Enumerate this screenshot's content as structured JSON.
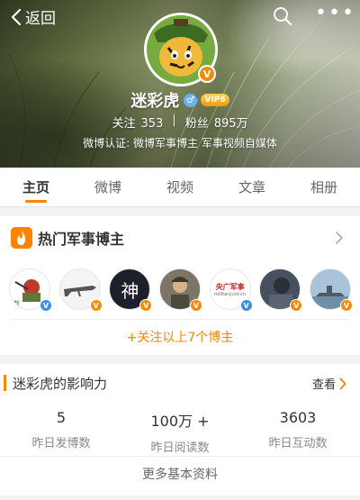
{
  "nav": {
    "back_label": "返回"
  },
  "profile": {
    "name": "迷彩虎",
    "gender_symbol": "♂",
    "vip_label": "VIP6",
    "following_label": "关注",
    "following_count": "353",
    "followers_label": "粉丝",
    "followers_count": "895万",
    "verification": "微博认证: 微博军事博主 军事视频自媒体"
  },
  "tabs": [
    {
      "label": "主页",
      "active": true
    },
    {
      "label": "微博",
      "active": false
    },
    {
      "label": "视频",
      "active": false
    },
    {
      "label": "文章",
      "active": false
    },
    {
      "label": "相册",
      "active": false
    }
  ],
  "hot": {
    "title": "热门军事博主",
    "follow_all_label": "+关注以上7个博主",
    "bloggers": [
      {
        "badge": "blue",
        "pic_text": ""
      },
      {
        "badge": "orange",
        "pic_text": ""
      },
      {
        "badge": "orange",
        "pic_text": "神"
      },
      {
        "badge": "orange",
        "pic_text": ""
      },
      {
        "badge": "blue",
        "pic_text": "央广军事",
        "pic_subtext": "military.cnr.cn"
      },
      {
        "badge": "orange",
        "pic_text": ""
      },
      {
        "badge": "orange",
        "pic_text": ""
      }
    ]
  },
  "influence": {
    "title": "迷彩虎的影响力",
    "more_label": "查看",
    "metrics": [
      {
        "value": "5",
        "label": "昨日发博数"
      },
      {
        "value": "100万 +",
        "label": "昨日阅读数"
      },
      {
        "value": "3603",
        "label": "昨日互动数"
      }
    ],
    "more_info_label": "更多基本资料"
  },
  "colors": {
    "accent": "#ff8200",
    "verify_orange": "#f28b0c",
    "verify_blue": "#3a8ee6"
  }
}
